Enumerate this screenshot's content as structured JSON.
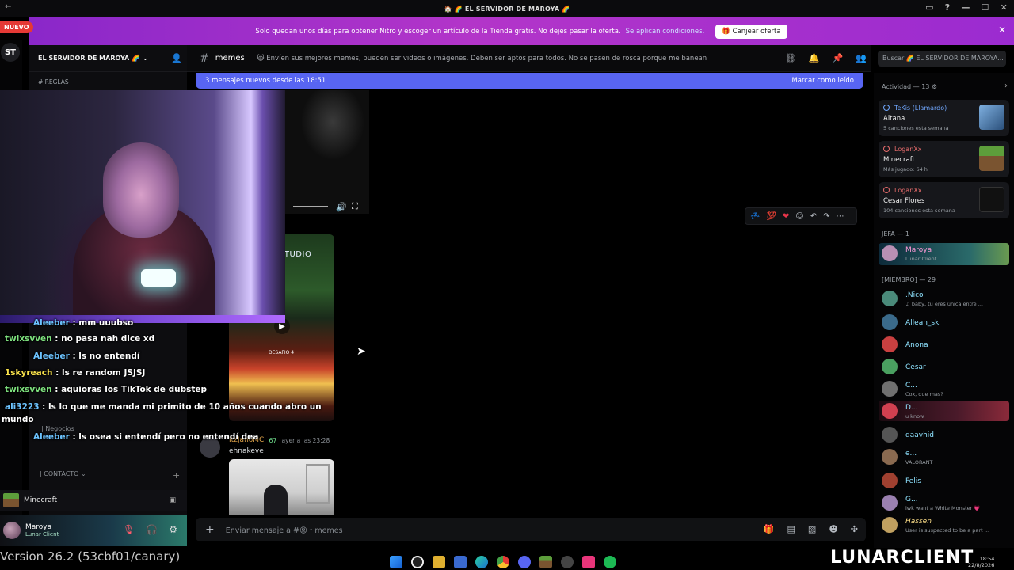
{
  "window": {
    "title": "🏠 🌈 EL SERVIDOR DE MAROYA 🌈"
  },
  "nuevo_badge": "NUEVO",
  "server_rail": {
    "st": "ST"
  },
  "banner": {
    "text": "Solo quedan unos días para obtener Nitro y escoger un artículo de la Tienda gratis. No dejes pasar la oferta.",
    "link": "Se aplican condiciones.",
    "button": "Canjear oferta"
  },
  "server": {
    "name": "EL SERVIDOR DE MAROYA 🌈",
    "rules_channel": "REGLAS"
  },
  "categories": {
    "negocios": "| Negocios",
    "contacto": "| CONTACTO"
  },
  "activity": {
    "game": "Minecraft"
  },
  "user": {
    "name": "Maroya",
    "status": "Lunar Client"
  },
  "version": "Version 26.2 (53cbf01/canary)",
  "stream_chat": [
    {
      "name": "Aleeber",
      "text": ": mm uuubso"
    },
    {
      "name": "twixsvven",
      "text": ": no pasa nah dice xd"
    },
    {
      "name": "Aleeber",
      "text": ": ls no entendí"
    },
    {
      "name": "1skyreach",
      "text": ": ls re random JSJSJ"
    },
    {
      "name": "twixsvven",
      "text": ": aquioras los TikTok de dubstep"
    },
    {
      "name": "ali3223",
      "text": ": ls lo que me manda mi primito de 10 años cuando abro un"
    },
    {
      "name": "",
      "text": "mundo"
    },
    {
      "name": "Aleeber",
      "text": ": ls osea si entendí pero no entendí dea"
    }
  ],
  "channel": {
    "name": "memes",
    "topic": "😸 Envíen sus mejores memes, pueden ser videos o imágenes. Deben ser aptos para todos. No se pasen de rosca porque me banean"
  },
  "search": {
    "placeholder": "Buscar 🌈 EL SERVIDOR DE MAROYA..."
  },
  "new_messages": {
    "text": "3 mensajes nuevos desde las 18:51",
    "mark_read": "Marcar como leído"
  },
  "media": {
    "studio_label": "A STUDIO",
    "desafio_label": "DESAFIO 4"
  },
  "message": {
    "author": "ItzJanoMC",
    "badge": "67",
    "time": "ayer a las 23:28",
    "text": "ehnakeve"
  },
  "composer": {
    "placeholder": "Enviar mensaje a #😡・memes"
  },
  "right_panel": {
    "activity_header": "Actividad — 13",
    "activities": [
      {
        "who": "TeKis (Llamardo)",
        "what": "Aitana",
        "sub": "5 canciones esta semana"
      },
      {
        "who": "LoganXx",
        "what": "Minecraft",
        "sub": "Más jugado: 64 h"
      },
      {
        "who": "LoganXx",
        "what": "Cesar Flores",
        "sub": "104 canciones esta semana"
      }
    ],
    "jefa_header": "JEFA — 1",
    "jefa": [
      {
        "name": "Maroya",
        "status": "Lunar Client"
      }
    ],
    "miembro_header": "[MIEMBRO] — 29",
    "members": [
      {
        "name": ".Nico",
        "status": "♫ baby, tu eres única entre ..."
      },
      {
        "name": "Allean_sk",
        "status": ""
      },
      {
        "name": "Anona",
        "status": ""
      },
      {
        "name": "Cesar",
        "status": ""
      },
      {
        "name": "C...",
        "status": "Cox, que mas?"
      },
      {
        "name": "D...",
        "status": "u know"
      },
      {
        "name": "daavhid",
        "status": ""
      },
      {
        "name": "e...",
        "status": "VALORANT"
      },
      {
        "name": "Felis",
        "status": ""
      },
      {
        "name": "G...",
        "status": "iwk want a White Monster 💗"
      },
      {
        "name": "Hassen",
        "status": "User is suspected to be a part ..."
      }
    ]
  },
  "watermark": "LUNARCLIENT",
  "clock": {
    "time": "18:54",
    "date": "22/8/2026"
  }
}
